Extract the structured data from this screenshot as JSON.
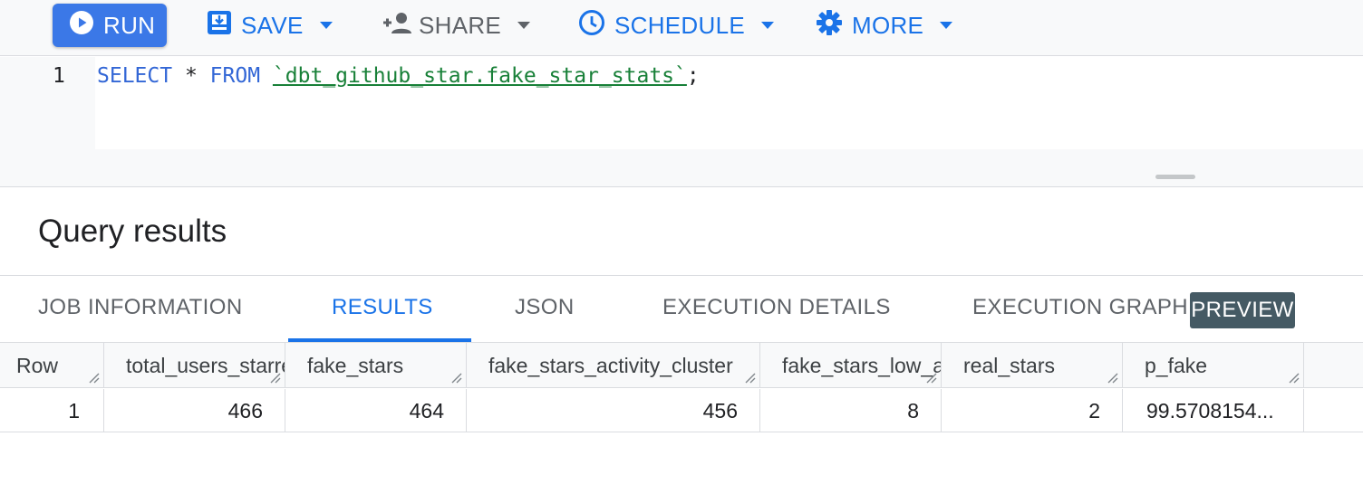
{
  "toolbar": {
    "run_label": "RUN",
    "save_label": "SAVE",
    "share_label": "SHARE",
    "schedule_label": "SCHEDULE",
    "more_label": "MORE",
    "accent_color": "#3b78e7",
    "icons": [
      "play-icon",
      "save-icon",
      "add-person-icon",
      "clock-icon",
      "gear-icon",
      "caret-down-icon"
    ]
  },
  "editor": {
    "line_number": "1",
    "kw_select": "SELECT",
    "op_star": "*",
    "kw_from": "FROM",
    "table_ref": "`dbt_github_star.fake_star_stats`",
    "semicolon": ";"
  },
  "results": {
    "title": "Query results",
    "tabs": {
      "job_information": "JOB INFORMATION",
      "results": "RESULTS",
      "json": "JSON",
      "execution_details": "EXECUTION DETAILS",
      "execution_graph": "EXECUTION GRAPH",
      "preview_badge": "PREVIEW"
    },
    "active_tab": "RESULTS",
    "columns": [
      "Row",
      "total_users_starred",
      "fake_stars",
      "fake_stars_activity_cluster",
      "fake_stars_low_activity",
      "real_stars",
      "p_fake"
    ],
    "rows": [
      [
        "1",
        "466",
        "464",
        "456",
        "8",
        "2",
        "99.5708154..."
      ]
    ]
  }
}
